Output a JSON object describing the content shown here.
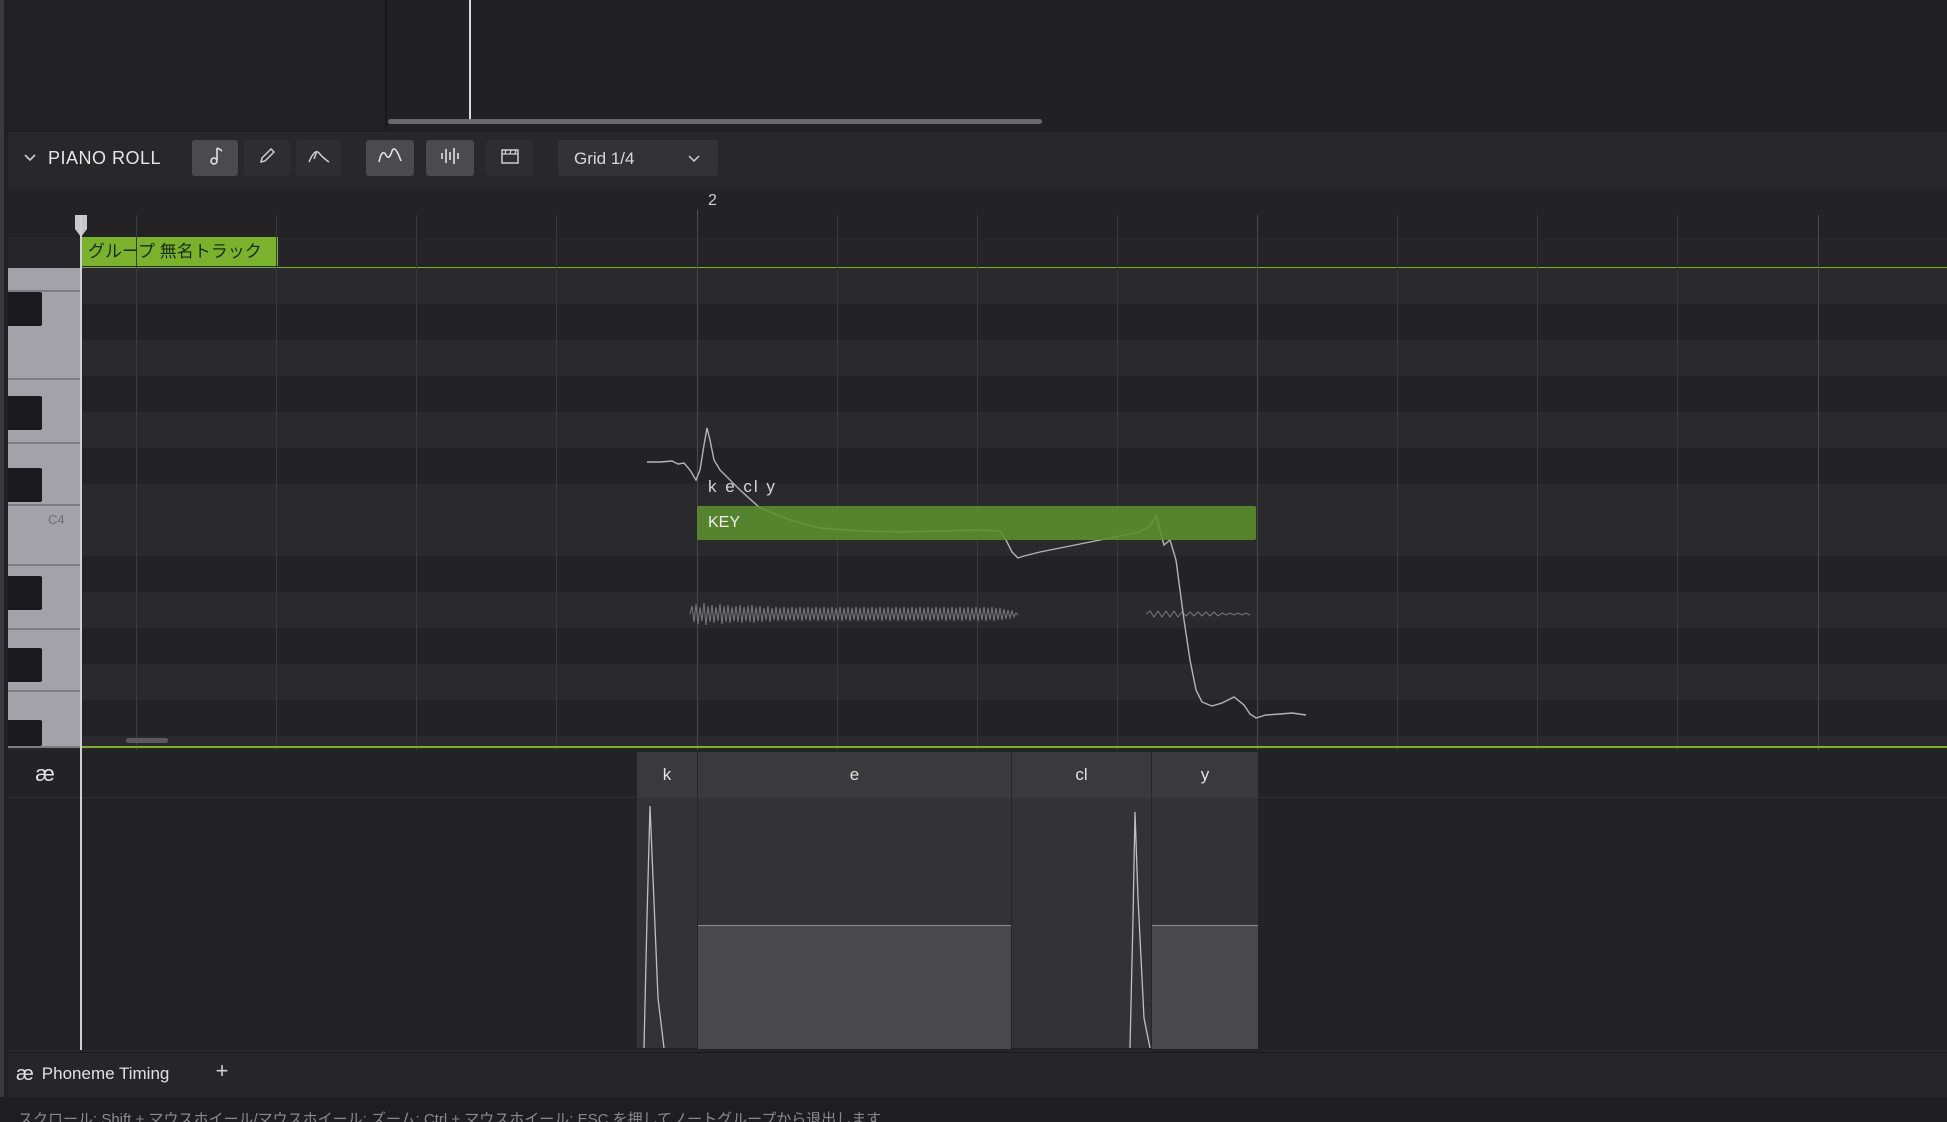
{
  "toolbar": {
    "panel_title": "PIANO ROLL",
    "grid_select": "Grid 1/4"
  },
  "ruler": {
    "bar_number": "2"
  },
  "group": {
    "label": "グループ 無名トラック"
  },
  "keyboard": {
    "c4_label": "C4"
  },
  "note": {
    "label": "KEY",
    "lyrics": "k e cl y"
  },
  "phonemes": {
    "icon_glyph": "æ",
    "items": [
      "k",
      "e",
      "cl",
      "y"
    ]
  },
  "footer": {
    "tab_icon": "æ",
    "tab_label": "Phoneme Timing",
    "add_label": "+"
  },
  "status": {
    "text": "スクロール: Shift + マウスホイール/マウスホイール: ズーム: Ctrl + マウスホイール: ESC を押してノートグループから退出します"
  },
  "colors": {
    "accent_green": "#7ab22e",
    "note_green": "#5c8f2e",
    "background": "#1f1f21"
  }
}
